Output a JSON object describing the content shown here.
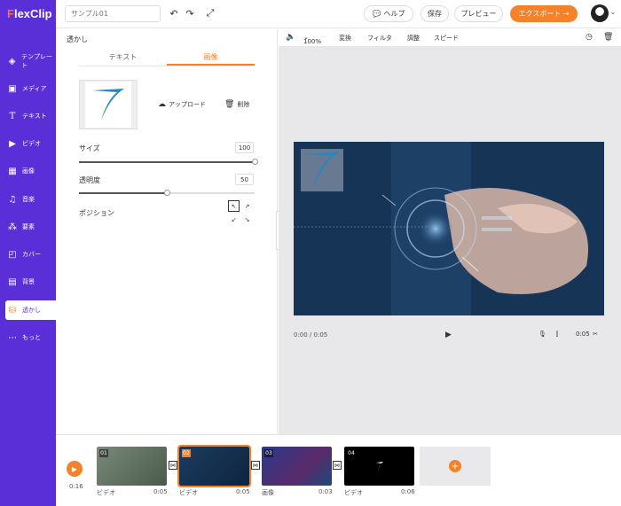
{
  "app": {
    "logo_prefix": "F",
    "logo_rest": "lexClip"
  },
  "sidebar": {
    "items": [
      {
        "label": "テンプレート",
        "icon": "layers-icon"
      },
      {
        "label": "メディア",
        "icon": "folder-icon"
      },
      {
        "label": "テキスト",
        "icon": "text-icon"
      },
      {
        "label": "ビデオ",
        "icon": "video-icon"
      },
      {
        "label": "画像",
        "icon": "image-icon"
      },
      {
        "label": "音楽",
        "icon": "music-icon"
      },
      {
        "label": "要素",
        "icon": "elements-icon"
      },
      {
        "label": "カバー",
        "icon": "cover-icon"
      },
      {
        "label": "背景",
        "icon": "background-icon"
      },
      {
        "label": "透かし",
        "icon": "watermark-icon",
        "active": true
      },
      {
        "label": "もっと",
        "icon": "more-icon"
      }
    ]
  },
  "topbar": {
    "project_name_placeholder": "サンプル01",
    "help_label": "ヘルプ",
    "save_label": "保存",
    "preview_label": "プレビュー",
    "export_label": "エクスポート →"
  },
  "panel": {
    "title": "透かし",
    "tabs": [
      {
        "label": "テキスト",
        "active": false
      },
      {
        "label": "画像",
        "active": true
      }
    ],
    "upload_label": "アップロード",
    "delete_label": "削除",
    "size": {
      "label": "サイズ",
      "value": "100",
      "fraction": 1.0
    },
    "opacity": {
      "label": "透明度",
      "value": "50",
      "fraction": 0.5
    },
    "position_label": "ポジション"
  },
  "editor": {
    "zoom": "100%",
    "tools": [
      "変換",
      "フィルタ",
      "調整",
      "スピード"
    ],
    "current_time": "0:00 / 0:05",
    "duration": "0:05"
  },
  "timeline": {
    "current": "0:16",
    "clips": [
      {
        "num": "01",
        "type": "ビデオ",
        "duration": "0:05"
      },
      {
        "num": "02",
        "type": "ビデオ",
        "duration": "0:05",
        "selected": true
      },
      {
        "num": "03",
        "type": "画像",
        "duration": "0:03"
      },
      {
        "num": "04",
        "type": "ビデオ",
        "duration": "0:06"
      }
    ],
    "add_label": "+"
  },
  "colors": {
    "accent": "#f5822a",
    "sidebar": "#5b2fd8"
  }
}
